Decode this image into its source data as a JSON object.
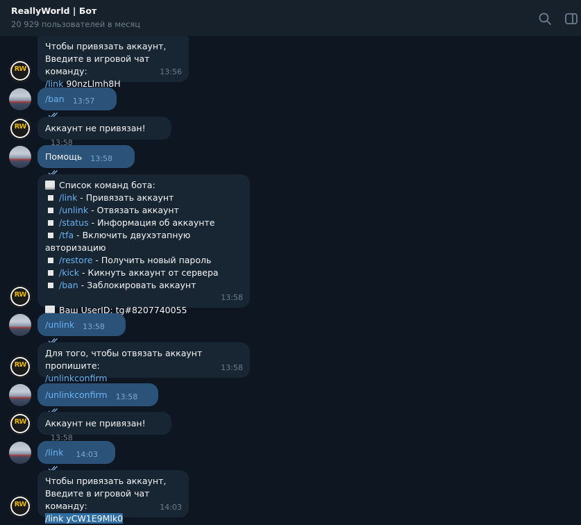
{
  "header": {
    "title": "ReallyWorld | Бот",
    "subtitle": "20 929 пользователей в месяц"
  },
  "icons": {
    "search": "search-icon",
    "panel": "sidebar-toggle-icon"
  },
  "messages": [
    {
      "lines": [
        "Чтобы привязать аккаунт,",
        "Введите в игровой чат команду:"
      ],
      "cmd": "/link",
      "code": "90nzLlmh8H",
      "time": "13:56"
    },
    {
      "text": "/ban",
      "time": "13:57"
    },
    {
      "text": "Аккаунт не привязан!",
      "time": "13:58"
    },
    {
      "text": "Помощь",
      "time": "13:58"
    },
    {
      "heading": "Список команд бота:",
      "commands": [
        {
          "cmd": "/link",
          "desc": " - Привязать аккаунт"
        },
        {
          "cmd": "/unlink",
          "desc": " - Отвязать аккаунт"
        },
        {
          "cmd": "/status",
          "desc": " - Информация об аккаунте"
        },
        {
          "cmd": "/tfa",
          "desc": " - Включить двухэтапную авторизацию"
        },
        {
          "cmd": "/restore",
          "desc": " - Получить новый пароль"
        },
        {
          "cmd": "/kick",
          "desc": " - Кикнуть аккаунт от сервера"
        },
        {
          "cmd": "/ban",
          "desc": " - Заблокировать аккаунт"
        }
      ],
      "userid": "Ваш UserID: tg#8207740055",
      "time": "13:58"
    },
    {
      "text": "/unlink",
      "time": "13:58"
    },
    {
      "line": "Для того, чтобы отвязать аккаунт пропишите:",
      "cmd": "/unlinkconfirm",
      "time": "13:58"
    },
    {
      "text": "/unlinkconfirm",
      "time": "13:58"
    },
    {
      "text": "Аккаунт не привязан!",
      "time": "13:58"
    },
    {
      "text": "/link",
      "time": "14:03"
    },
    {
      "lines": [
        "Чтобы привязать аккаунт,",
        "Введите в игровой чат команду:"
      ],
      "cmd": "/link",
      "code": "yCW1E9Mlk0",
      "time": "14:03"
    }
  ],
  "colors": {
    "background": "#0e1621",
    "header": "#17212b",
    "incoming": "#182533",
    "outgoing": "#2b5278",
    "link": "#6ab3f3"
  }
}
